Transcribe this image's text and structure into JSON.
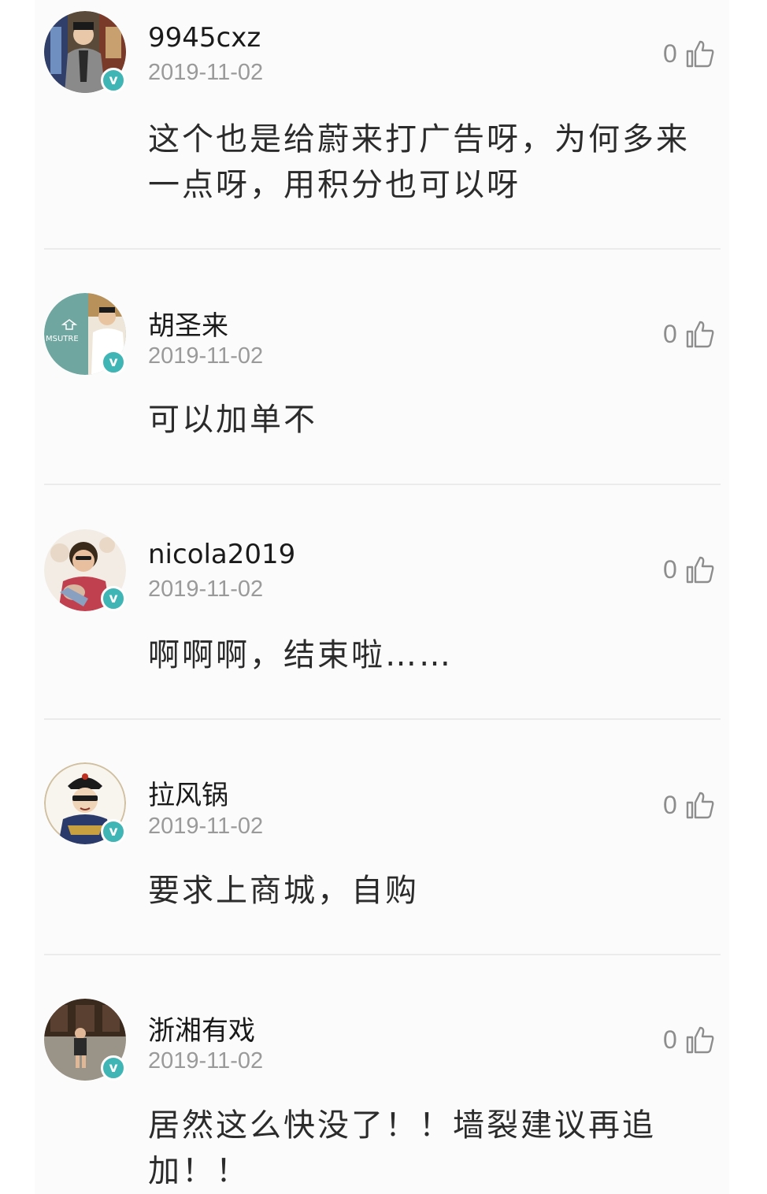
{
  "comments": [
    {
      "username": "9945cxz",
      "date": "2019-11-02",
      "likes": "0",
      "text": "这个也是给蔚来打广告呀，为何多来一点呀，用积分也可以呀",
      "verified": "v"
    },
    {
      "username": "胡圣来",
      "date": "2019-11-02",
      "likes": "0",
      "text": "可以加单不",
      "verified": "v",
      "avatar_text": "MSUTRE"
    },
    {
      "username": "nicola2019",
      "date": "2019-11-02",
      "likes": "0",
      "text": "啊啊啊，结束啦……",
      "verified": "v"
    },
    {
      "username": "拉风锅",
      "date": "2019-11-02",
      "likes": "0",
      "text": "要求上商城，自购",
      "verified": "v"
    },
    {
      "username": "浙湘有戏",
      "date": "2019-11-02",
      "likes": "0",
      "text": "居然这么快没了！！墙裂建议再追加！！",
      "verified": "v"
    }
  ],
  "icons": {
    "like": "thumbs-up-icon",
    "badge": "verified-badge-icon"
  },
  "colors": {
    "badge": "#3fb5b5",
    "username": "#1a1a1a",
    "date": "#9a9a9a",
    "text": "#2b2b2b",
    "like": "#8d8d8d"
  }
}
